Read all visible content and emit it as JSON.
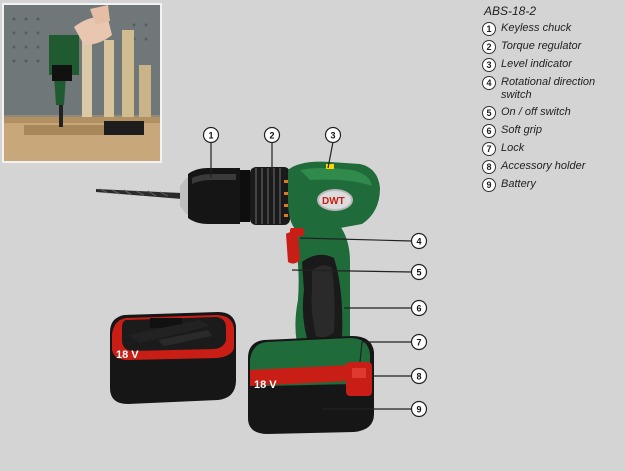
{
  "legend": {
    "title": "ABS-18-2",
    "items": [
      {
        "num": "1",
        "label": "Keyless chuck"
      },
      {
        "num": "2",
        "label": "Torque regulator"
      },
      {
        "num": "3",
        "label": "Level indicator"
      },
      {
        "num": "4",
        "label": "Rotational direction switch"
      },
      {
        "num": "5",
        "label": "On / off switch"
      },
      {
        "num": "6",
        "label": "Soft grip"
      },
      {
        "num": "7",
        "label": "Lock"
      },
      {
        "num": "8",
        "label": "Accessory holder"
      },
      {
        "num": "9",
        "label": "Battery"
      }
    ]
  },
  "product": {
    "brand_logo": "DWT",
    "battery_voltage_main": "18 V",
    "battery_voltage_spare": "18 V"
  },
  "callouts": [
    "1",
    "2",
    "3",
    "4",
    "5",
    "6",
    "7",
    "8",
    "9"
  ],
  "colors": {
    "background": "#d4d4d4",
    "drill_green": "#1f6b3a",
    "accent_red": "#c81e16",
    "rubber_black": "#1a1a1a"
  }
}
